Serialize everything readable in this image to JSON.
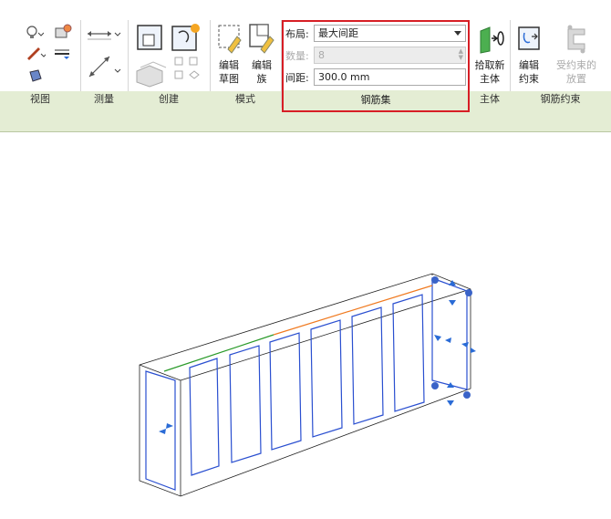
{
  "panels": {
    "view": {
      "title": "视图"
    },
    "measure": {
      "title": "测量"
    },
    "create": {
      "title": "创建"
    },
    "mode": {
      "title": "模式",
      "edit_sketch": [
        "编辑",
        "草图"
      ],
      "edit_family": [
        "编辑",
        "族"
      ]
    },
    "rebar_set": {
      "title": "钢筋集",
      "layout_label": "布局:",
      "layout_value": "最大间距",
      "quantity_label": "数量:",
      "quantity_value": "8",
      "spacing_label": "间距:",
      "spacing_value": "300.0 mm"
    },
    "host": {
      "title": "主体",
      "pick_new_host": [
        "拾取新",
        "主体"
      ]
    },
    "constraint": {
      "title": "钢筋约束",
      "edit_constraints": [
        "编辑",
        "约束"
      ],
      "constrained_placement": [
        "受约束的",
        "放置"
      ]
    }
  },
  "colors": {
    "highlight_border": "#d71e25",
    "ribbon_band": "#e4edd4",
    "rebar_blue": "#2a4fd0"
  }
}
